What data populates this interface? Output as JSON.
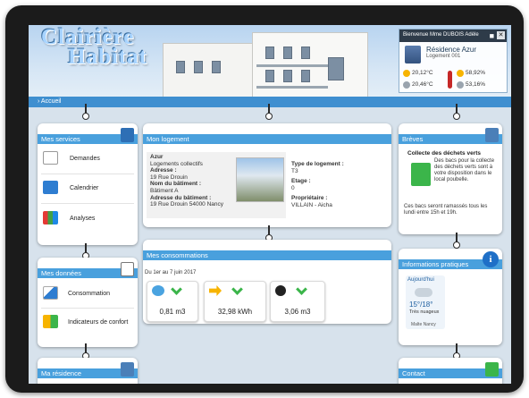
{
  "header": {
    "logo_line1": "Clairière",
    "logo_line2": "Habitat",
    "breadcrumb": "Accueil",
    "welcome": "Bienvenue Mme DUBOIS Adèle",
    "residence_name": "Résidence Azur",
    "residence_unit": "Logement 001",
    "weather": {
      "day_temp": "20,12°C",
      "night_temp": "20,46°C",
      "day_humidity": "58,92%",
      "night_humidity": "53,16%"
    }
  },
  "services": {
    "title": "Mes services",
    "items": [
      "Demandes",
      "Calendrier",
      "Analyses"
    ]
  },
  "logement": {
    "title": "Mon logement",
    "name": "Azur",
    "subtitle": "Logements collectifs",
    "address_label": "Adresse :",
    "address": "19 Rue Drouin",
    "building_label": "Nom du bâtiment :",
    "building": "Bâtiment A",
    "building_address_label": "Adresse du bâtiment :",
    "building_address": "19 Rue Drouin 54000 Nancy",
    "type_label": "Type de logement :",
    "type": "T3",
    "floor_label": "Etage :",
    "floor": "0",
    "owner_label": "Propriétaire :",
    "owner": "VILLAIN - Aicha"
  },
  "breves": {
    "title": "Brèves",
    "headline": "Collecte des déchets verts",
    "body": "Des bacs pour la collecte des déchets verts sont à votre disposition dans le local poubelle.",
    "note": "Ces bacs seront ramassés tous les lundi entre 15h et 19h."
  },
  "donnees": {
    "title": "Mes données",
    "items": [
      "Consommation",
      "Indicateurs de confort"
    ]
  },
  "consommations": {
    "title": "Mes consommations",
    "period": "Du 1er au 7 juin 2017",
    "meters": [
      {
        "icon": "water-icon",
        "value": "0,81 m3"
      },
      {
        "icon": "electricity-icon",
        "value": "32,98 kWh"
      },
      {
        "icon": "gas-icon",
        "value": "3,06 m3"
      }
    ]
  },
  "infos": {
    "title": "Informations pratiques",
    "today": "Aujourd'hui",
    "temps": "15°/18°",
    "condition": "Très nuageux",
    "city": "Malte Nancy"
  },
  "residence": {
    "title": "Ma résidence"
  },
  "contact": {
    "title": "Contact"
  },
  "colors": {
    "accent": "#49a0dd",
    "dark": "#1b1b1b",
    "green": "#3bb54a"
  }
}
